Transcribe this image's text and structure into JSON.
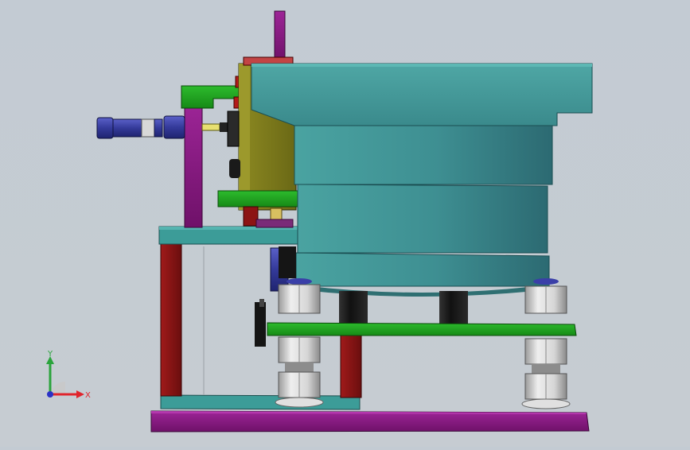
{
  "view": {
    "background_top": "#c3cbd3",
    "background_bottom": "#c6ccd2"
  },
  "colors": {
    "teal": "#3e9292",
    "teal_dark": "#2d6f74",
    "purple": "#8a1a86",
    "green": "#1fa21f",
    "dark_red": "#8c1414",
    "olive": "#7c7a1c",
    "navy": "#3a3f9a",
    "steel": "#c8c8c8",
    "black": "#151515"
  },
  "triad": {
    "x_label": "X",
    "y_label": "Y",
    "x_color": "#e0242c",
    "y_color": "#2aa43c",
    "z_color": "#2b32c6"
  }
}
